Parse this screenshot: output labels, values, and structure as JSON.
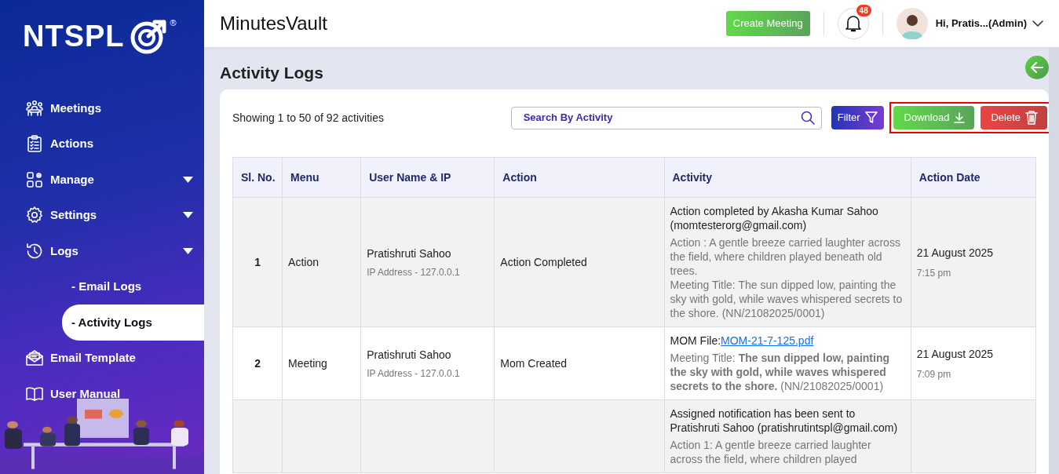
{
  "sidebar": {
    "logo": {
      "text": "NTSPL",
      "registered": "®"
    },
    "items": [
      {
        "label": "Meetings",
        "kind": "meetings",
        "dropdown": false
      },
      {
        "label": "Actions",
        "kind": "actions",
        "dropdown": false
      },
      {
        "label": "Manage",
        "kind": "manage",
        "dropdown": true
      },
      {
        "label": "Settings",
        "kind": "settings",
        "dropdown": true
      },
      {
        "label": "Logs",
        "kind": "logs",
        "dropdown": true,
        "children": [
          {
            "label": "- Email Logs",
            "selected": false
          },
          {
            "label": "- Activity Logs",
            "selected": true
          }
        ]
      },
      {
        "label": "Email Template",
        "kind": "email",
        "dropdown": false
      },
      {
        "label": "User Manual",
        "kind": "manual",
        "dropdown": false
      }
    ]
  },
  "header": {
    "title": "MinutesVault",
    "create_button": "Create Meeting",
    "notification_count": "48",
    "greeting": "Hi, Pratis...(Admin)"
  },
  "page": {
    "title": "Activity Logs",
    "summary": "Showing 1 to 50 of 92 activities",
    "search": {
      "placeholder": "Search By Activity"
    },
    "buttons": [
      {
        "label": "Filter",
        "kind": "filter"
      },
      {
        "label": "Download",
        "kind": "download"
      },
      {
        "label": "Delete",
        "kind": "delete"
      }
    ],
    "highlight_export_group": true
  },
  "table": {
    "columns": [
      "Sl. No.",
      "Menu",
      "User Name & IP",
      "Action",
      "Activity",
      "Action Date"
    ],
    "rows": [
      {
        "sl": "1",
        "menu": "Action",
        "user": "Pratishruti Sahoo",
        "ip": "IP Address - 127.0.0.1",
        "action": "Action Completed",
        "activity": {
          "text": "Action completed by Akasha Kumar Sahoo (momtesterorg@gmail.com)",
          "details": [
            "Action : A gentle breeze carried laughter across the field, where children played beneath old trees.",
            "Meeting Title: The sun dipped low, painting the sky with gold, while waves whispered secrets to the shore. (NN/21082025/0001)"
          ]
        },
        "date": "21 August 2025",
        "time": "7:15 pm"
      },
      {
        "sl": "2",
        "menu": "Meeting",
        "user": "Pratishruti Sahoo",
        "ip": "IP Address - 127.0.0.1",
        "action": "Mom Created",
        "activity": {
          "text": "MOM File:",
          "link": "MOM-21-7-125.pdf",
          "details": [
            "Meeting Title: **The sun dipped low, painting the sky with gold, while waves whispered secrets to the shore.** (NN/21082025/0001)"
          ]
        },
        "date": "21 August 2025",
        "time": "7:09 pm"
      },
      {
        "activity": {
          "text": "Assigned notification has been sent to Pratishruti Sahoo (pratishrutintspl@gmail.com)",
          "details": [
            "Action 1: A gentle breeze carried laughter across the field, where children played"
          ]
        }
      }
    ]
  }
}
